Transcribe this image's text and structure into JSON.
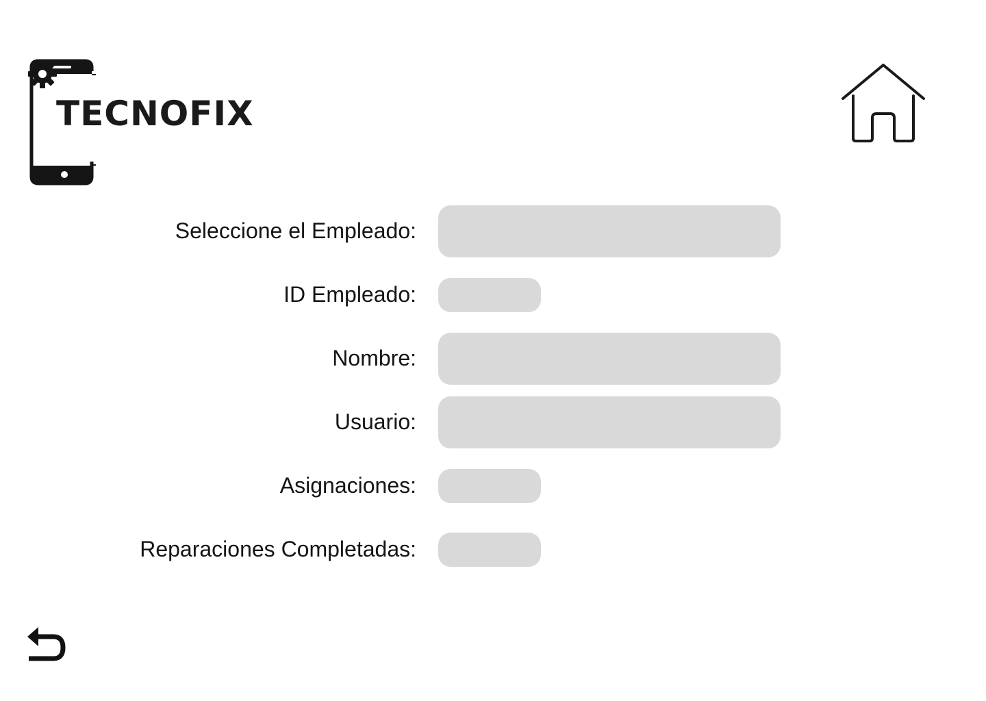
{
  "logo": {
    "text": "TECNOFIX",
    "icon": "phone-gear-logo"
  },
  "header": {
    "home_icon": "home-icon"
  },
  "form": {
    "employee_select": {
      "label": "Seleccione el Empleado:",
      "value": ""
    },
    "employee_id": {
      "label": "ID Empleado:",
      "value": ""
    },
    "name": {
      "label": "Nombre:",
      "value": ""
    },
    "user": {
      "label": "Usuario:",
      "value": ""
    },
    "assignments": {
      "label": "Asignaciones:",
      "value": ""
    },
    "completed_repairs": {
      "label": "Reparaciones Completadas:",
      "value": ""
    }
  },
  "footer": {
    "back_icon": "undo-arrow-icon"
  },
  "colors": {
    "field_background": "#d9d9d9",
    "text": "#151515",
    "background": "#ffffff"
  }
}
